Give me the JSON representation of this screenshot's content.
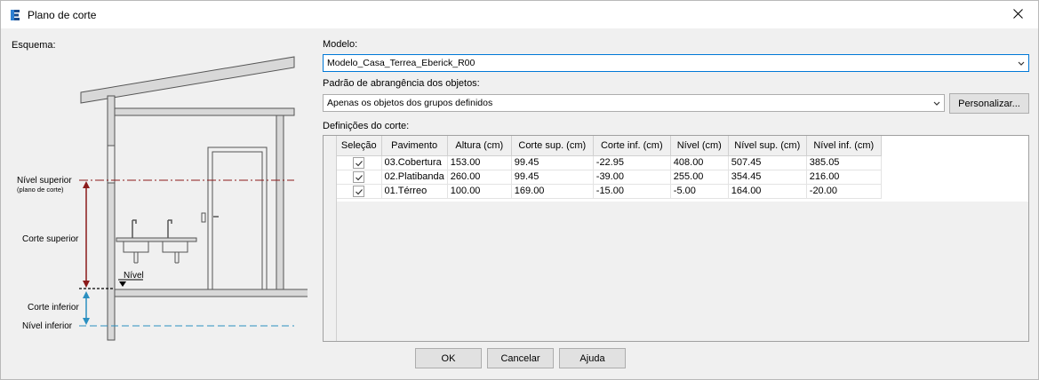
{
  "window": {
    "title": "Plano de corte"
  },
  "esquema": {
    "label": "Esquema:",
    "nivel_superior": "Nível superior",
    "plano_de_corte": "(plano de corte)",
    "corte_superior": "Corte superior",
    "corte_inferior": "Corte inferior",
    "nivel_inferior": "Nível inferior",
    "nivel": "Nível"
  },
  "modelo": {
    "label": "Modelo:",
    "value": "Modelo_Casa_Terrea_Eberick_R00"
  },
  "padrao": {
    "label": "Padrão de abrangência dos objetos:",
    "value": "Apenas os objetos dos grupos definidos",
    "personalizar_label": "Personalizar..."
  },
  "definicoes": {
    "label": "Definições do corte:",
    "columns": [
      "Seleção",
      "Pavimento",
      "Altura (cm)",
      "Corte sup. (cm)",
      "Corte inf. (cm)",
      "Nível (cm)",
      "Nível sup. (cm)",
      "Nível inf. (cm)"
    ],
    "rows": [
      {
        "selected": true,
        "pavimento": "03.Cobertura",
        "altura": "153.00",
        "corte_sup": "99.45",
        "corte_inf": "-22.95",
        "nivel": "408.00",
        "nivel_sup": "507.45",
        "nivel_inf": "385.05"
      },
      {
        "selected": true,
        "pavimento": "02.Platibanda",
        "altura": "260.00",
        "corte_sup": "99.45",
        "corte_inf": "-39.00",
        "nivel": "255.00",
        "nivel_sup": "354.45",
        "nivel_inf": "216.00"
      },
      {
        "selected": true,
        "pavimento": "01.Térreo",
        "altura": "100.00",
        "corte_sup": "169.00",
        "corte_inf": "-15.00",
        "nivel": "-5.00",
        "nivel_sup": "164.00",
        "nivel_inf": "-20.00"
      }
    ]
  },
  "buttons": {
    "ok": "OK",
    "cancelar": "Cancelar",
    "ajuda": "Ajuda"
  },
  "icons": {
    "app": "eberick-logo-icon",
    "close": "close-icon",
    "dropdown": "chevron-down-icon",
    "check": "check-icon"
  },
  "colors": {
    "nivel_superior_line": "#8b1a1a",
    "nivel_inferior_line": "#2a8fc0",
    "app_icon": "#1a4a8a",
    "focus_border": "#0078d7"
  }
}
